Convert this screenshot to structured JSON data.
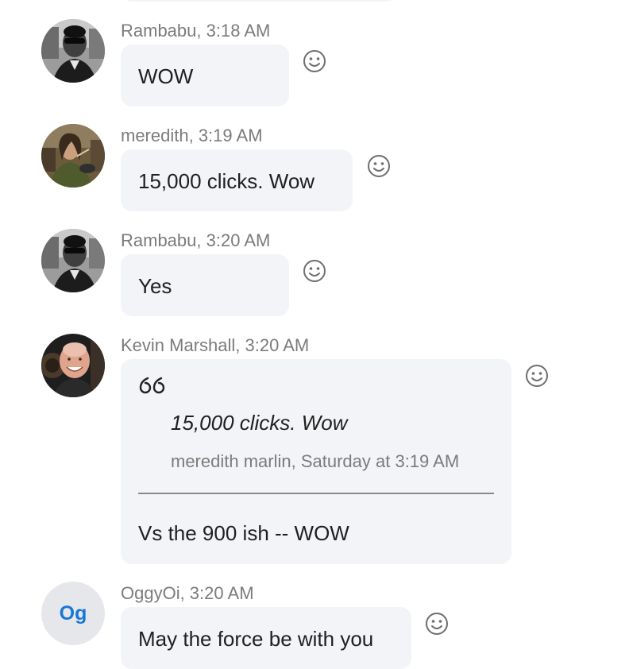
{
  "messages": [
    {
      "author": "Rambabu",
      "time": "3:18 AM",
      "meta": "Rambabu, 3:18 AM",
      "text": "WOW",
      "avatar": "photo-rambabu"
    },
    {
      "author": "meredith",
      "time": "3:19 AM",
      "meta": "meredith, 3:19 AM",
      "text": "15,000 clicks.  Wow",
      "avatar": "photo-meredith"
    },
    {
      "author": "Rambabu",
      "time": "3:20 AM",
      "meta": "Rambabu, 3:20 AM",
      "text": "Yes",
      "avatar": "photo-rambabu"
    },
    {
      "author": "Kevin Marshall",
      "time": "3:20 AM",
      "meta": "Kevin Marshall, 3:20 AM",
      "avatar": "photo-kevin",
      "quote": {
        "text": "15,000 clicks.  Wow",
        "source": "meredith marlin, Saturday at 3:19 AM"
      },
      "text": "Vs the 900  ish  -- WOW"
    },
    {
      "author": "OggyOi",
      "time": "3:20 AM",
      "meta": "OggyOi, 3:20 AM",
      "text": "May the force be with you",
      "avatar_initials": "Og"
    }
  ],
  "icons": {
    "reaction": "smiley-face-icon",
    "quote": "quote-mark-icon"
  },
  "colors": {
    "bubble": "#f2f4f7",
    "meta": "#7b7b7b",
    "text": "#1f1f1f",
    "initials": "#1877d6",
    "initials_bg": "#e6e7eb"
  }
}
